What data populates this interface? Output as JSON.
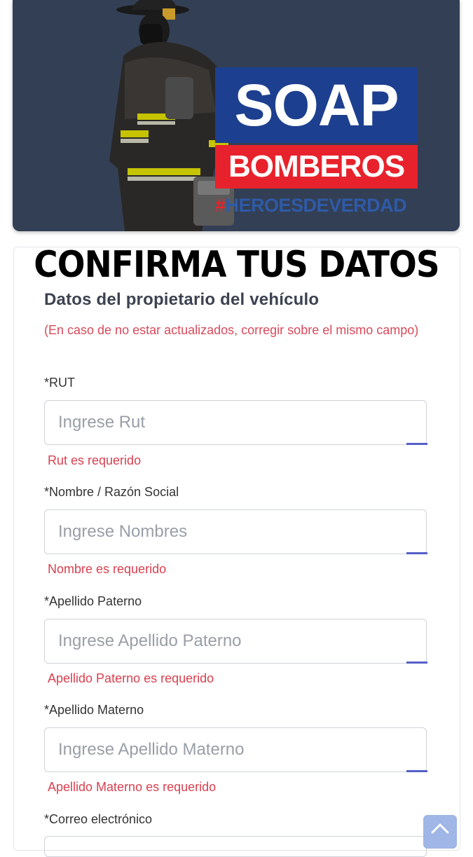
{
  "banner": {
    "logo_main": "SOAP",
    "logo_sub": "BOMBEROS",
    "hashtag_symbol": "#",
    "hashtag_text": "HEROESDEVERDAD",
    "colors": {
      "background": "#333f54",
      "blue": "#1d3f8f",
      "red": "#e8222c"
    }
  },
  "headline": "CONFIRMA TUS DATOS",
  "section": {
    "title": "Datos del propietario del vehículo",
    "note": "(En caso de no estar actualizados, corregir sobre el mismo campo)"
  },
  "fields": [
    {
      "label": "*RUT",
      "placeholder": "Ingrese Rut",
      "value": "",
      "error": "Rut es requerido"
    },
    {
      "label": "*Nombre / Razón Social",
      "placeholder": "Ingrese Nombres",
      "value": "",
      "error": "Nombre es requerido"
    },
    {
      "label": "*Apellido Paterno",
      "placeholder": "Ingrese Apellido Paterno",
      "value": "",
      "error": "Apellido Paterno es requerido"
    },
    {
      "label": "*Apellido Materno",
      "placeholder": "Ingrese Apellido Materno",
      "value": "",
      "error": "Apellido Materno es requerido"
    },
    {
      "label": "*Correo electrónico",
      "placeholder": "",
      "value": ""
    }
  ],
  "scroll_top_icon": "chevron-up-icon",
  "colors": {
    "error": "#d9404f",
    "accent": "#5560c8"
  }
}
